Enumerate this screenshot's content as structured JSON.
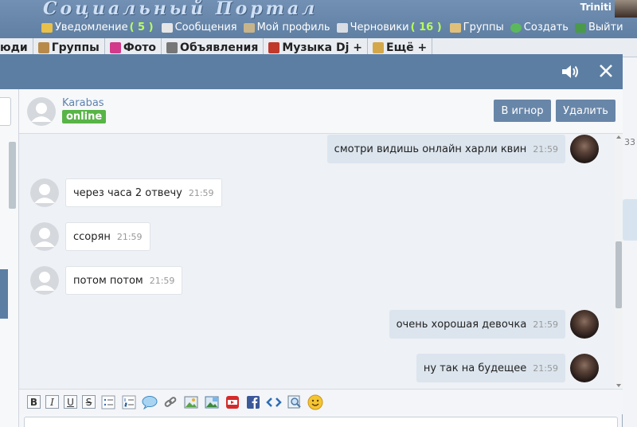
{
  "portal": {
    "title": "Социальный Портал",
    "user_name": "Triniti",
    "topnav": [
      {
        "label": "Уведомление",
        "count": "( 5 )",
        "icon": "bell-icon",
        "color": "#e8c04a"
      },
      {
        "label": "Сообщения",
        "icon": "envelope-icon",
        "color": "#e6e6e6"
      },
      {
        "label": "Мой профиль",
        "icon": "house-icon",
        "color": "#c8b48a"
      },
      {
        "label": "Черновики",
        "count": "( 16 )",
        "icon": "document-icon",
        "color": "#d9dde4"
      },
      {
        "label": "Группы",
        "icon": "people-icon",
        "color": "#e0c07a"
      },
      {
        "label": "Создать",
        "icon": "plus-circle-icon",
        "color": "#5cb85c"
      },
      {
        "label": "Выйти",
        "icon": "exit-icon",
        "color": "#4a9a4a"
      }
    ]
  },
  "nav2": [
    {
      "label": "юди"
    },
    {
      "label": "Группы",
      "icon": "people-icon",
      "color": "#b88a4a"
    },
    {
      "label": "Фото",
      "icon": "camera-icon",
      "color": "#d33a8a"
    },
    {
      "label": "Объявления",
      "icon": "newspaper-icon",
      "color": "#777777"
    },
    {
      "label": "Музыка Dj +",
      "icon": "music-note-icon",
      "color": "#c0392b"
    },
    {
      "label": "Ещё +",
      "icon": "more-icon",
      "color": "#d4a84a"
    }
  ],
  "background_page": {
    "number": "33"
  },
  "chat": {
    "contact_name": "Karabas",
    "contact_status": "online",
    "ignore_label": "В игнор",
    "delete_label": "Удалить",
    "messages": [
      {
        "dir": "out",
        "text": "смотри видишь онлайн харли квин",
        "time": "21:59"
      },
      {
        "dir": "in",
        "text": "через часа 2 отвечу",
        "time": "21:59"
      },
      {
        "dir": "in",
        "text": "ссорян",
        "time": "21:59"
      },
      {
        "dir": "in",
        "text": "потом потом",
        "time": "21:59"
      },
      {
        "dir": "out",
        "text": "очень хорошая девочка",
        "time": "21:59"
      },
      {
        "dir": "out",
        "text": "ну так на будещее",
        "time": "21:59"
      }
    ],
    "toolbar": [
      {
        "name": "bold-button",
        "label": "B",
        "style": "box"
      },
      {
        "name": "italic-button",
        "label": "I",
        "style": "box"
      },
      {
        "name": "underline-button",
        "label": "U",
        "style": "box"
      },
      {
        "name": "strikethrough-button",
        "label": "S",
        "style": "box"
      },
      {
        "name": "bullet-list-button",
        "icon": "bullet-list-icon"
      },
      {
        "name": "numbered-list-button",
        "icon": "numbered-list-icon"
      },
      {
        "name": "quote-button",
        "icon": "speech-bubble-icon"
      },
      {
        "name": "link-button",
        "icon": "chain-link-icon"
      },
      {
        "name": "image-button",
        "icon": "image-icon"
      },
      {
        "name": "photo-button",
        "icon": "photo-upload-icon"
      },
      {
        "name": "youtube-button",
        "icon": "youtube-icon"
      },
      {
        "name": "facebook-button",
        "icon": "facebook-icon"
      },
      {
        "name": "code-button",
        "icon": "code-arrows-icon"
      },
      {
        "name": "preview-button",
        "icon": "magnifier-icon"
      },
      {
        "name": "smiley-button",
        "icon": "smiley-icon"
      }
    ]
  }
}
